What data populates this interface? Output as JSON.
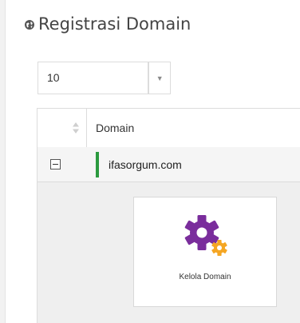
{
  "header": {
    "title": "Registrasi Domain",
    "title_icon": "globe-icon"
  },
  "page_length": {
    "selected": "10",
    "arrow_icon": "caret-down-icon"
  },
  "table": {
    "columns": [
      "Domain"
    ],
    "sort_icon": "sort-icon",
    "rows": [
      {
        "domain": "ifasorgum.com",
        "status_color": "#2b9a3f",
        "toggle_icon": "collapse-minus-icon"
      }
    ]
  },
  "detail": {
    "action_label": "Kelola Domain",
    "action_icon": "gear-icon",
    "icon_colors": {
      "primary": "#7a2d9c",
      "secondary": "#f5a623"
    }
  }
}
